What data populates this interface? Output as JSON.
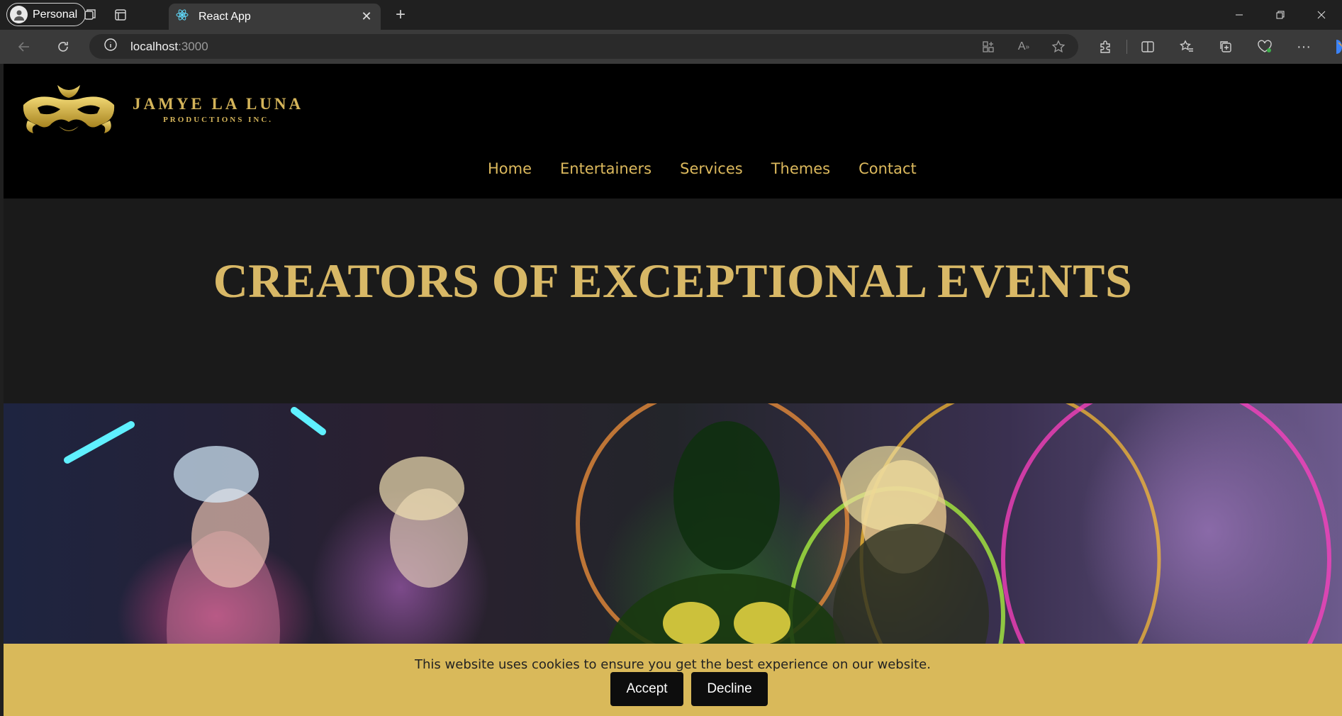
{
  "browser": {
    "profile_label": "Personal",
    "tab_title": "React App",
    "url_host": "localhost",
    "url_port": ":3000"
  },
  "site": {
    "logo_name": "JAMYE LA LUNA",
    "logo_sub": "PRODUCTIONS INC.",
    "nav": [
      "Home",
      "Entertainers",
      "Services",
      "Themes",
      "Contact"
    ],
    "hero_title": "CREATORS OF EXCEPTIONAL EVENTS"
  },
  "cookie": {
    "message": "This website uses cookies to ensure you get the best experience on our website.",
    "accept_label": "Accept",
    "decline_label": "Decline"
  },
  "colors": {
    "gold": "#d4b45a",
    "banner": "#d9b95a",
    "header_bg": "#000000",
    "hero_bg": "#1a1a1a"
  }
}
